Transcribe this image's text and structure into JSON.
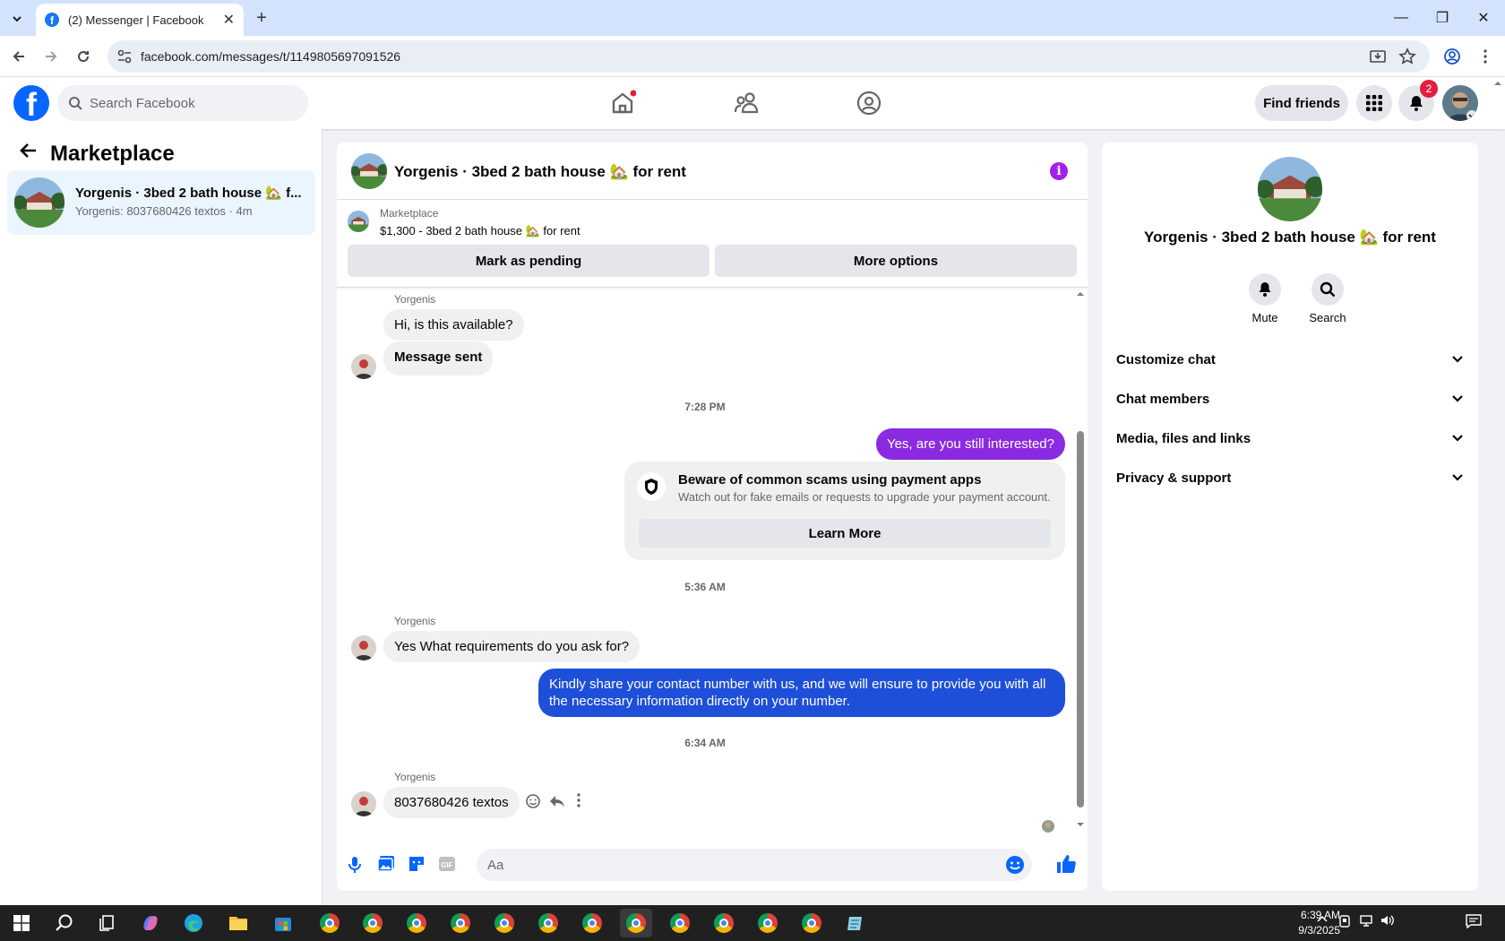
{
  "browser": {
    "tab_title": "(2) Messenger | Facebook",
    "url": "facebook.com/messages/t/1149805697091526"
  },
  "fb": {
    "search_placeholder": "Search Facebook",
    "find_friends": "Find friends",
    "notification_count": "2"
  },
  "left": {
    "title": "Marketplace",
    "conversation": {
      "name": "Yorgenis · 3bed 2 bath house 🏡 f...",
      "preview": "Yorgenis: 8037680426 textos · 4m"
    }
  },
  "chat": {
    "header_title": "Yorgenis · 3bed 2 bath house 🏡 for rent",
    "listing_label": "Marketplace",
    "listing_title": "$1,300 - 3bed 2 bath house 🏡 for rent",
    "mark_pending": "Mark as pending",
    "more_options": "More options",
    "sender_name": "Yorgenis",
    "messages": {
      "m1": "Hi, is this available?",
      "m2": "Message sent",
      "t1": "7:28 PM",
      "m3": "Yes, are you still interested?",
      "scam_title": "Beware of common scams using payment apps",
      "scam_body": "Watch out for fake emails or requests to upgrade your payment account.",
      "learn_more": "Learn More",
      "t2": "5:36 AM",
      "m4": "Yes What requirements do you ask for?",
      "m5": "Kindly share your contact number with us, and we will ensure to provide you with all the necessary information directly on your number.",
      "t3": "6:34 AM",
      "m6": "8037680426 textos"
    },
    "composer_placeholder": "Aa"
  },
  "right": {
    "title": "Yorgenis · 3bed 2 bath house 🏡 for rent",
    "mute": "Mute",
    "search": "Search",
    "sections": [
      "Customize chat",
      "Chat members",
      "Media, files and links",
      "Privacy & support"
    ]
  },
  "taskbar": {
    "time": "6:39 AM",
    "date": "9/3/2025"
  },
  "colors": {
    "fb_blue": "#0866ff",
    "messenger_purple": "#8a2be2",
    "message_blue": "#1e4fd8"
  }
}
